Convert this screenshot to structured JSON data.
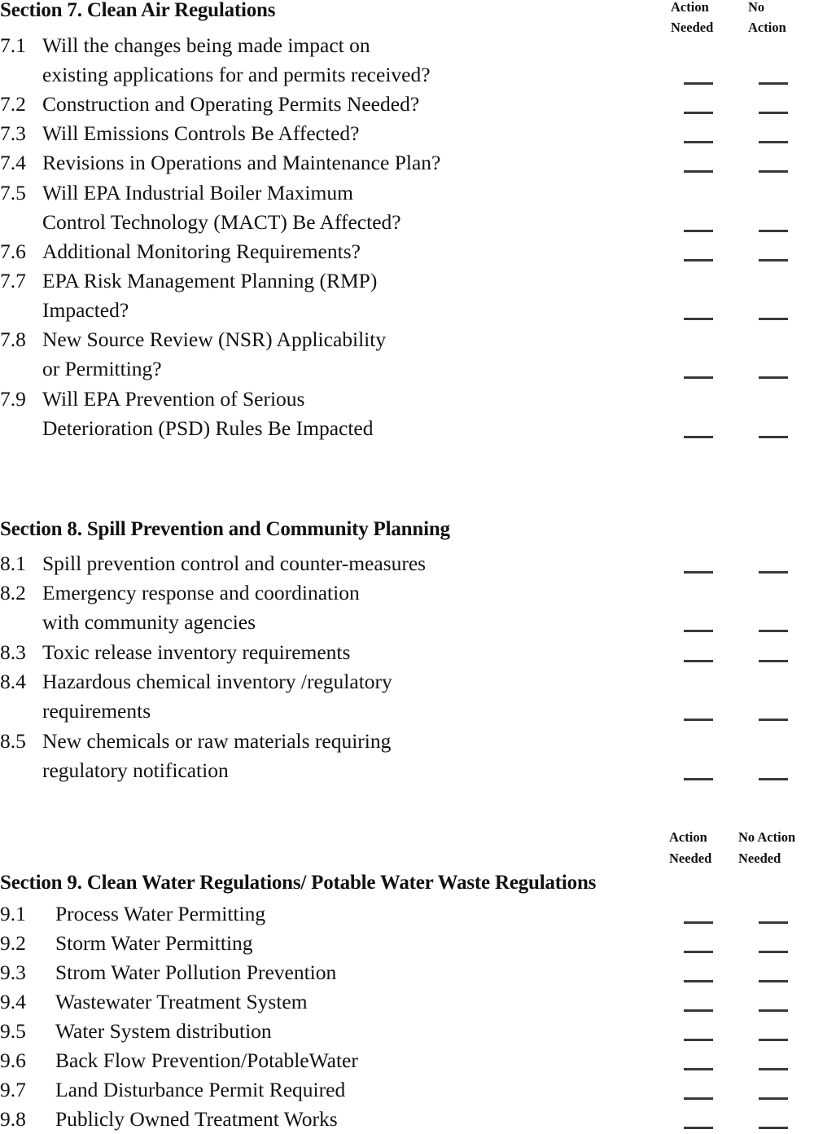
{
  "document": {
    "type": "environmental-regulatory-checklist",
    "columns": {
      "action_needed": "Action\nNeeded",
      "no_action": "No\nAction"
    }
  },
  "section7": {
    "title": "Section 7. Clean Air Regulations",
    "col_head_1_line1": "Action",
    "col_head_1_line2": "Needed",
    "col_head_2_line1": "No",
    "col_head_2_line2": "Action",
    "items": [
      {
        "num": "7.1",
        "line1": "Will the changes being made impact on",
        "line2": "existing applications for and permits received?"
      },
      {
        "num": "7.2",
        "line1": "Construction and Operating Permits Needed?",
        "line2": ""
      },
      {
        "num": "7.3",
        "line1": "Will Emissions Controls Be Affected?",
        "line2": ""
      },
      {
        "num": "7.4",
        "line1": "Revisions in Operations and Maintenance Plan?",
        "line2": ""
      },
      {
        "num": "7.5",
        "line1": "Will EPA Industrial Boiler Maximum",
        "line2": "Control Technology (MACT) Be Affected?"
      },
      {
        "num": "7.6",
        "line1": "Additional Monitoring Requirements?",
        "line2": ""
      },
      {
        "num": "7.7",
        "line1": "EPA Risk Management Planning (RMP)",
        "line2": "Impacted?"
      },
      {
        "num": "7.8",
        "line1": "New Source Review (NSR) Applicability",
        "line2": "or Permitting?"
      },
      {
        "num": "7.9",
        "line1": "Will EPA Prevention of Serious",
        "line2": "Deterioration (PSD) Rules Be Impacted"
      }
    ]
  },
  "section8": {
    "title": "Section 8. Spill Prevention and Community Planning",
    "items": [
      {
        "num": "8.1",
        "line1": "Spill prevention control and counter-measures",
        "line2": ""
      },
      {
        "num": "8.2",
        "line1": "Emergency response and coordination",
        "line2": "with community agencies"
      },
      {
        "num": "8.3",
        "line1": "Toxic release inventory requirements",
        "line2": ""
      },
      {
        "num": "8.4",
        "line1": "Hazardous chemical inventory /regulatory",
        "line2": "requirements"
      },
      {
        "num": "8.5",
        "line1": "New chemicals or raw materials requiring",
        "line2": "regulatory notification"
      }
    ]
  },
  "section9": {
    "title": "Section 9. Clean Water Regulations/ Potable Water Waste Regulations",
    "col_head_1_line1": "Action",
    "col_head_1_line2": "Needed",
    "col_head_2_line1": "No Action",
    "col_head_2_line2": "Needed",
    "items": [
      {
        "num": "9.1",
        "line1": "Process Water Permitting",
        "line2": ""
      },
      {
        "num": "9.2",
        "line1": "Storm Water Permitting",
        "line2": ""
      },
      {
        "num": "9.3",
        "line1": "Strom Water Pollution Prevention",
        "line2": ""
      },
      {
        "num": "9.4",
        "line1": "Wastewater Treatment System",
        "line2": ""
      },
      {
        "num": "9.5",
        "line1": "Water System distribution",
        "line2": ""
      },
      {
        "num": "9.6",
        "line1": "Back Flow Prevention/PotableWater",
        "line2": ""
      },
      {
        "num": "9.7",
        "line1": "Land Disturbance Permit Required",
        "line2": ""
      },
      {
        "num": "9.8",
        "line1": "Publicly Owned Treatment Works",
        "line2": ""
      }
    ]
  }
}
